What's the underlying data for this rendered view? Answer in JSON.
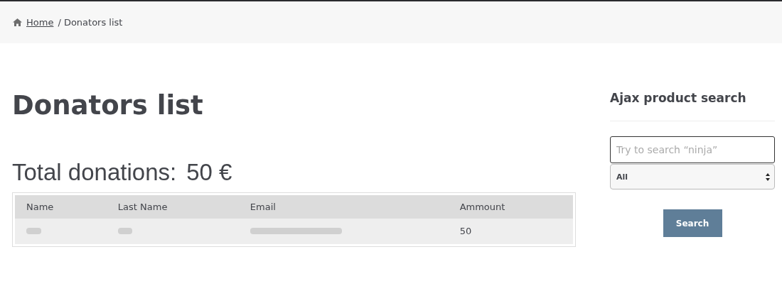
{
  "breadcrumb": {
    "link": "Home",
    "current": "/ Donators list"
  },
  "page_title": "Donators list",
  "total": {
    "label": "Total donations:",
    "value": "50 €"
  },
  "table": {
    "columns": [
      "Name",
      "Last Name",
      "Email",
      "Ammount"
    ],
    "rows": [
      {
        "cells": [
          {
            "kind": "redacted"
          },
          {
            "kind": "redacted"
          },
          {
            "kind": "redacted"
          },
          {
            "kind": "text",
            "text": "50"
          }
        ]
      }
    ]
  },
  "sidebar": {
    "title": "Ajax product search",
    "search": {
      "placeholder": "Try to search “ninja”"
    },
    "category": {
      "value": "All"
    },
    "button": "Search"
  }
}
